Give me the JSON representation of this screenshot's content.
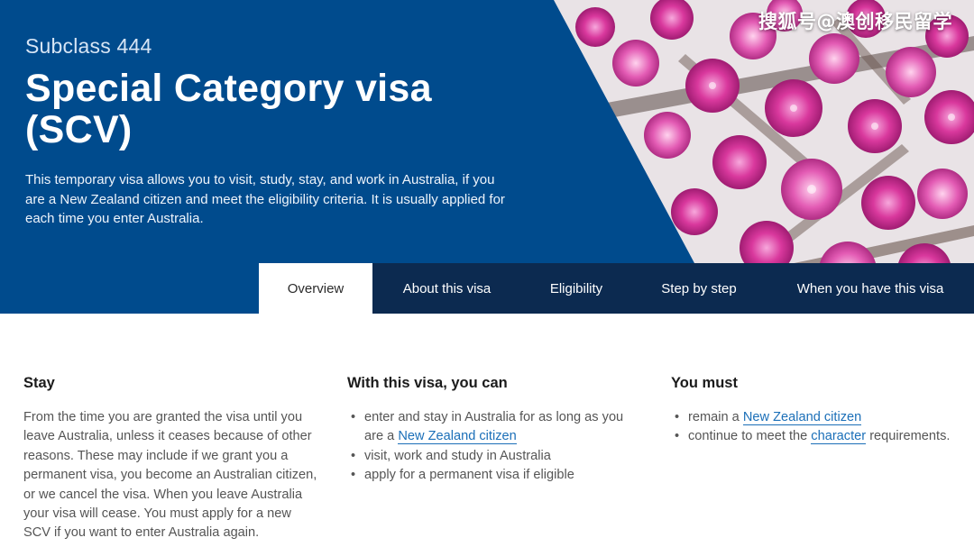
{
  "hero": {
    "subclass": "Subclass 444",
    "title_line1": "Special Category visa",
    "title_line2": "(SCV)",
    "intro": "This temporary visa allows you to visit, study, stay, and work in Australia, if you are a New Zealand citizen and meet the eligibility criteria. It is usually applied for each time you enter Australia.",
    "panel_color": "#004b8d",
    "image_subject": "pink blossom flowers"
  },
  "watermark": "搜狐号@澳创移民留学",
  "tabs": [
    {
      "label": "Overview",
      "active": true
    },
    {
      "label": "About this visa",
      "active": false
    },
    {
      "label": "Eligibility",
      "active": false
    },
    {
      "label": "Step by step",
      "active": false
    },
    {
      "label": "When you have this visa",
      "active": false
    }
  ],
  "stay": {
    "heading": "Stay",
    "text": "From the time you are granted the visa until you leave Australia, unless it ceases because of other reasons. These may include if we grant you a permanent visa, you become an Australian citizen, or we cancel the visa. When you leave Australia your visa will cease. You must apply for a new SCV if you want to enter Australia again."
  },
  "can": {
    "heading": "With this visa, you can",
    "item1_text": "enter and stay in Australia for as long as you are a ",
    "item1_link": "New Zealand citizen",
    "item2_text": "visit, work and study in Australia",
    "item3_text": "apply for a permanent visa if eligible"
  },
  "must": {
    "heading": "You must",
    "item1_text": "remain a ",
    "item1_link": "New Zealand citizen",
    "item2_pre": "continue to meet the ",
    "item2_link": "character",
    "item2_post": " requirements."
  },
  "colors": {
    "panel": "#004b8d",
    "tab_bar": "#0c2a50",
    "link": "#1b6fb8"
  }
}
